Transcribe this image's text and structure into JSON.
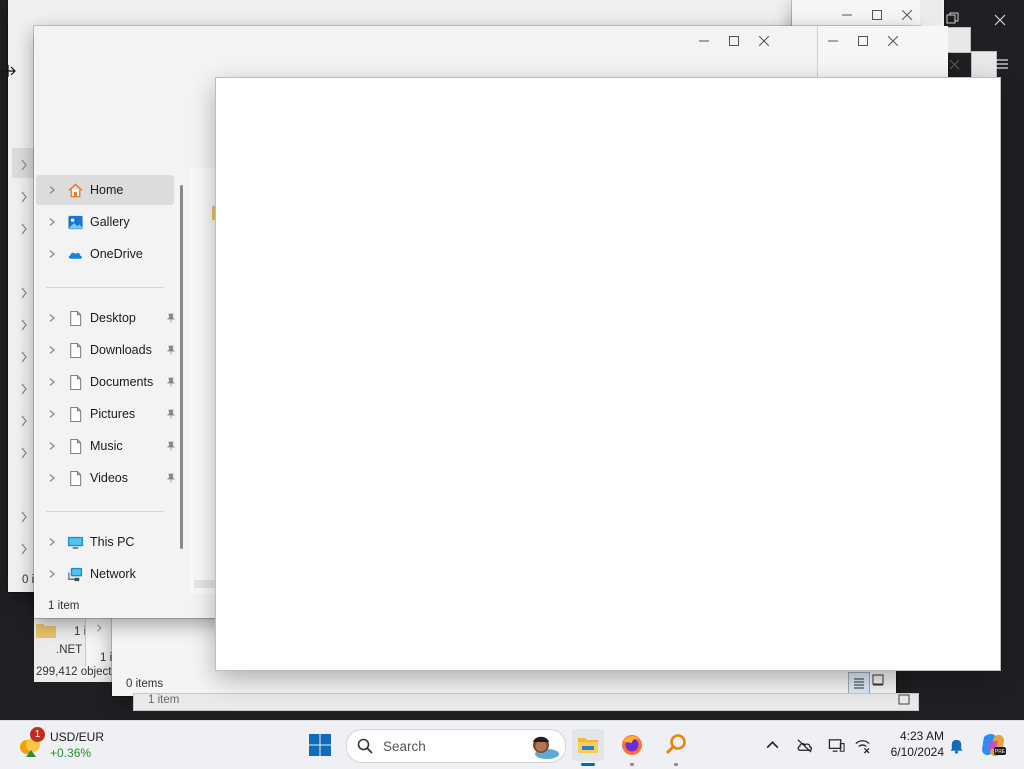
{
  "background_windows": {
    "edge_labels": [
      "0 i",
      "1 i",
      "1 i"
    ],
    "net_label": ".NET",
    "object_count": "299,412 objects",
    "items_count_mid": "0 items",
    "items_count_back": "1 item"
  },
  "explorer": {
    "nav_items": [
      {
        "label": "Home",
        "icon": "home-icon"
      },
      {
        "label": "Gallery",
        "icon": "gallery-icon"
      },
      {
        "label": "OneDrive",
        "icon": "onedrive-icon"
      }
    ],
    "quick_access": [
      {
        "label": "Desktop",
        "icon": "file-icon"
      },
      {
        "label": "Downloads",
        "icon": "file-icon"
      },
      {
        "label": "Documents",
        "icon": "file-icon"
      },
      {
        "label": "Pictures",
        "icon": "file-icon"
      },
      {
        "label": "Music",
        "icon": "file-icon"
      },
      {
        "label": "Videos",
        "icon": "file-icon"
      }
    ],
    "devices": [
      {
        "label": "This PC",
        "icon": "monitor-icon"
      },
      {
        "label": "Network",
        "icon": "network-icon"
      }
    ],
    "status": "1 item"
  },
  "taskbar": {
    "widget": {
      "badge": "1",
      "title": "USD/EUR",
      "change": "+0.36%"
    },
    "search_label": "Search",
    "time": "4:23 AM",
    "date": "6/10/2024",
    "colors": {
      "accent": "#0067c0",
      "positive": "#2e8b2e"
    }
  }
}
